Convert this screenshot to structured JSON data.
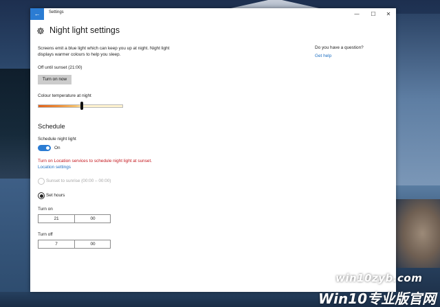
{
  "titlebar": {
    "back_icon": "back-arrow-icon",
    "back_glyph": "←",
    "title": "Settings",
    "minimize_glyph": "—",
    "maximize_glyph": "☐",
    "close_glyph": "✕"
  },
  "page": {
    "icon": "gear-icon",
    "title": "Night light settings",
    "description": "Screens emit a blue light which can keep you up at night. Night light displays warmer colours to help you sleep.",
    "status": "Off until sunset (21:00)",
    "turn_on_button": "Turn on now"
  },
  "colour_temperature": {
    "label": "Colour temperature at night",
    "level": 0.52
  },
  "schedule": {
    "heading": "Schedule",
    "toggle_label": "Schedule night light",
    "toggle_state": "On",
    "warning": "Turn on Location services to schedule night light at sunset.",
    "location_link": "Location settings",
    "option_sunset": "Sunset to sunrise (00:00 – 00:00)",
    "option_set_hours": "Set hours",
    "selected_option": "set_hours",
    "turn_on": {
      "label": "Turn on",
      "hour": "21",
      "minute": "00"
    },
    "turn_off": {
      "label": "Turn off",
      "hour": "7",
      "minute": "00"
    }
  },
  "help": {
    "heading": "Do you have a question?",
    "link": "Get help"
  },
  "watermark": {
    "top": "win10zyb.com",
    "bottom": "Win10专业版官网"
  },
  "colors": {
    "accent": "#2b7cd3",
    "warning": "#c3151b",
    "link": "#1e6fc2",
    "slider_warm": "#e0621c",
    "slider_cool": "#fff3cf"
  }
}
